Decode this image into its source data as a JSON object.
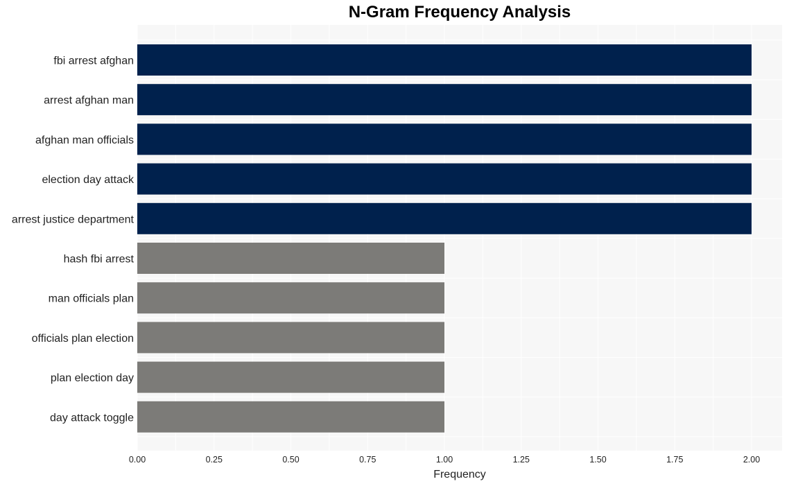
{
  "chart_data": {
    "type": "bar",
    "orientation": "horizontal",
    "title": "N-Gram Frequency Analysis",
    "xlabel": "Frequency",
    "ylabel": "",
    "xlim": [
      0,
      2.1
    ],
    "xticks": [
      "0.00",
      "0.25",
      "0.50",
      "0.75",
      "1.00",
      "1.25",
      "1.50",
      "1.75",
      "2.00"
    ],
    "xtick_values": [
      0,
      0.25,
      0.5,
      0.75,
      1.0,
      1.25,
      1.5,
      1.75,
      2.0
    ],
    "grid": true,
    "categories": [
      "fbi arrest afghan",
      "arrest afghan man",
      "afghan man officials",
      "election day attack",
      "arrest justice department",
      "hash fbi arrest",
      "man officials plan",
      "officials plan election",
      "plan election day",
      "day attack toggle"
    ],
    "values": [
      2,
      2,
      2,
      2,
      2,
      1,
      1,
      1,
      1,
      1
    ],
    "colors": {
      "high": "#00214d",
      "low": "#7c7b78",
      "plot_background": "#f7f7f7",
      "grid": "#ffffff"
    }
  }
}
